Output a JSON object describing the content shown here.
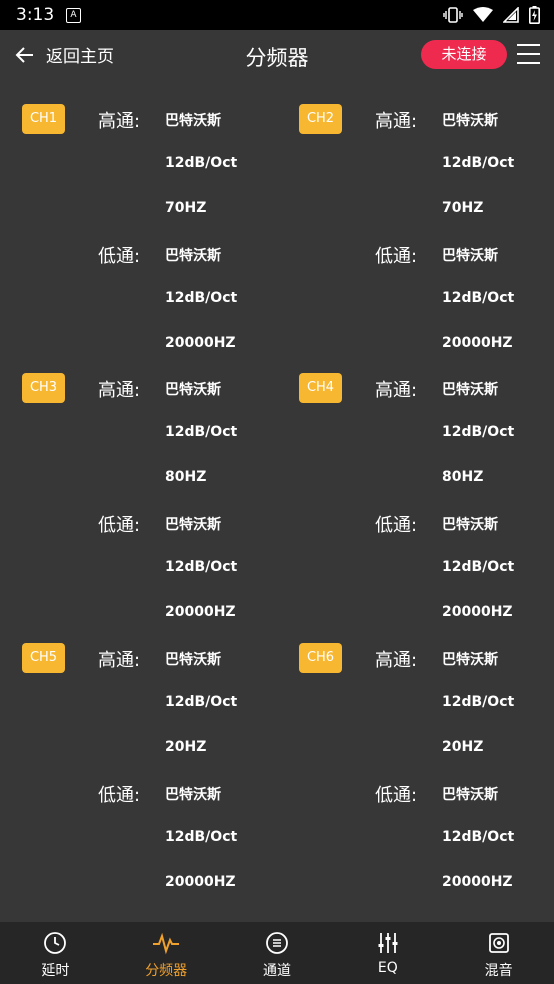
{
  "status_bar": {
    "time": "3:13",
    "notification_icon": "A"
  },
  "header": {
    "back_label": "返回主页",
    "title": "分频器",
    "connection_status": "未连接"
  },
  "labels": {
    "high_pass": "高通:",
    "low_pass": "低通:"
  },
  "channels": [
    {
      "name": "CH1",
      "high": {
        "type": "巴特沃斯",
        "slope": "12dB/Oct",
        "freq": "70HZ"
      },
      "low": {
        "type": "巴特沃斯",
        "slope": "12dB/Oct",
        "freq": "20000HZ"
      }
    },
    {
      "name": "CH2",
      "high": {
        "type": "巴特沃斯",
        "slope": "12dB/Oct",
        "freq": "70HZ"
      },
      "low": {
        "type": "巴特沃斯",
        "slope": "12dB/Oct",
        "freq": "20000HZ"
      }
    },
    {
      "name": "CH3",
      "high": {
        "type": "巴特沃斯",
        "slope": "12dB/Oct",
        "freq": "80HZ"
      },
      "low": {
        "type": "巴特沃斯",
        "slope": "12dB/Oct",
        "freq": "20000HZ"
      }
    },
    {
      "name": "CH4",
      "high": {
        "type": "巴特沃斯",
        "slope": "12dB/Oct",
        "freq": "80HZ"
      },
      "low": {
        "type": "巴特沃斯",
        "slope": "12dB/Oct",
        "freq": "20000HZ"
      }
    },
    {
      "name": "CH5",
      "high": {
        "type": "巴特沃斯",
        "slope": "12dB/Oct",
        "freq": "20HZ"
      },
      "low": {
        "type": "巴特沃斯",
        "slope": "12dB/Oct",
        "freq": "20000HZ"
      }
    },
    {
      "name": "CH6",
      "high": {
        "type": "巴特沃斯",
        "slope": "12dB/Oct",
        "freq": "20HZ"
      },
      "low": {
        "type": "巴特沃斯",
        "slope": "12dB/Oct",
        "freq": "20000HZ"
      }
    }
  ],
  "tabs": [
    {
      "label": "延时",
      "icon": "clock-icon"
    },
    {
      "label": "分频器",
      "icon": "pulse-icon",
      "active": true
    },
    {
      "label": "通道",
      "icon": "channel-icon"
    },
    {
      "label": "EQ",
      "icon": "sliders-icon"
    },
    {
      "label": "混音",
      "icon": "speaker-icon"
    }
  ],
  "colors": {
    "accent": "#f7b731",
    "active_tab": "#f0a02c",
    "disconnected": "#ef2a4f",
    "background": "#373737",
    "tab_bar": "#262626"
  }
}
